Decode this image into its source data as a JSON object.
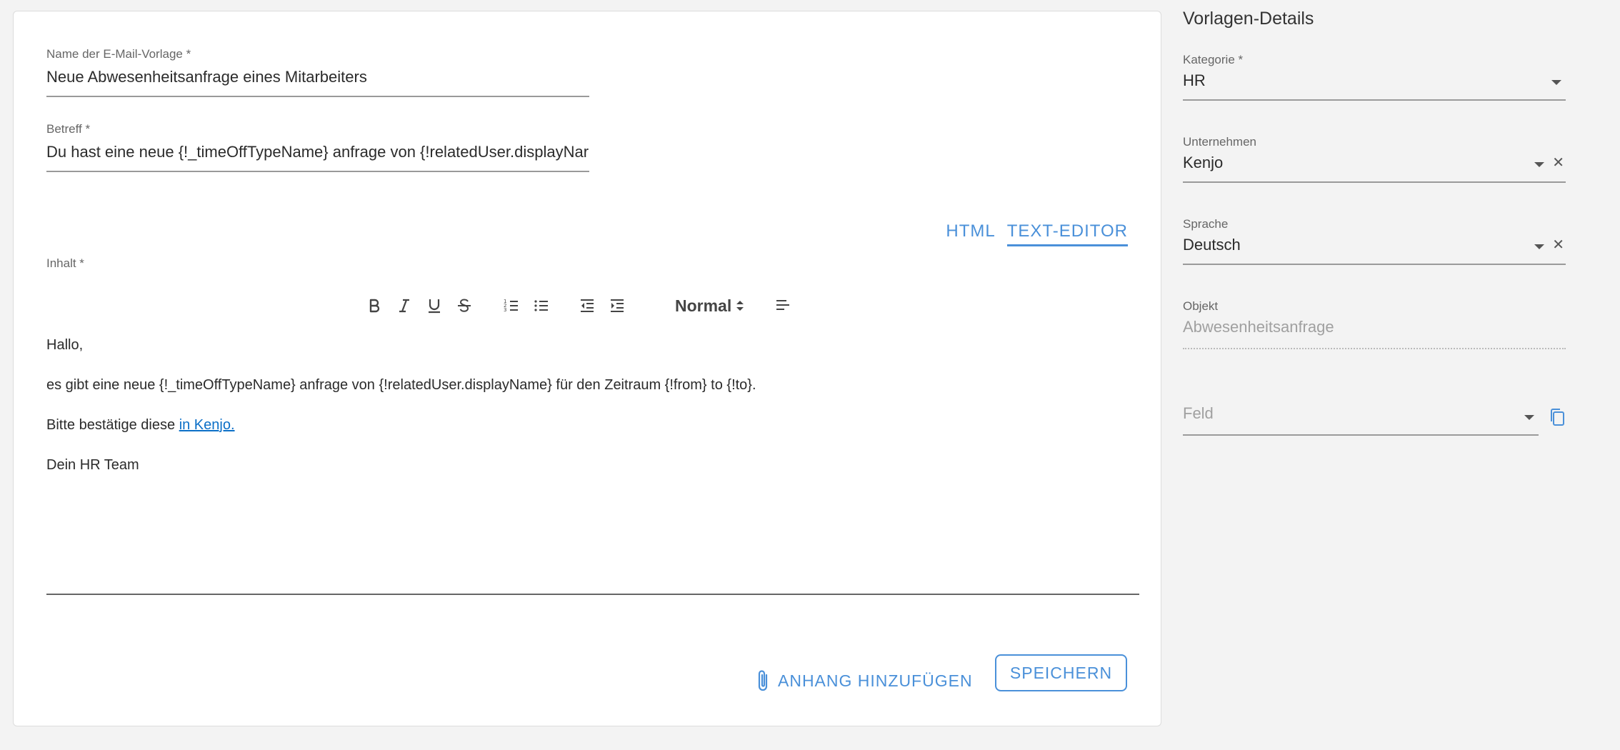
{
  "form": {
    "template_name": {
      "label": "Name der E-Mail-Vorlage *",
      "value": "Neue Abwesenheitsanfrage eines Mitarbeiters"
    },
    "subject": {
      "label": "Betreff *",
      "value": "Du hast eine neue {!_timeOffTypeName} anfrage von {!relatedUser.displayNar"
    },
    "content_label": "Inhalt *"
  },
  "mode_switch": {
    "html": "HTML",
    "text_editor": "TEXT-EDITOR",
    "active": "text_editor"
  },
  "toolbar": {
    "heading_select": "Normal",
    "buttons": [
      "bold-icon",
      "italic-icon",
      "underline-icon",
      "strikethrough-icon",
      "ordered-list-icon",
      "bullet-list-icon",
      "outdent-icon",
      "indent-icon",
      "align-icon"
    ]
  },
  "editor": {
    "line1": "Hallo,",
    "line2": "es gibt eine neue {!_timeOffTypeName} anfrage von {!relatedUser.displayName} für den Zeitraum {!from} to {!to}.",
    "line3_prefix": "Bitte bestätige diese ",
    "line3_link": "in Kenjo.",
    "line4": "Dein HR Team"
  },
  "actions": {
    "attach": "ANHANG HINZUFÜGEN",
    "save": "SPEICHERN"
  },
  "sidebar": {
    "title": "Vorlagen-Details",
    "category": {
      "label": "Kategorie *",
      "value": "HR"
    },
    "company": {
      "label": "Unternehmen",
      "value": "Kenjo"
    },
    "language": {
      "label": "Sprache",
      "value": "Deutsch"
    },
    "object": {
      "label": "Objekt",
      "value": "Abwesenheitsanfrage"
    },
    "field": {
      "placeholder": "Feld"
    }
  },
  "colors": {
    "accent": "#4a90d9",
    "link": "#0b6fc7",
    "background": "#f3f3f3"
  }
}
